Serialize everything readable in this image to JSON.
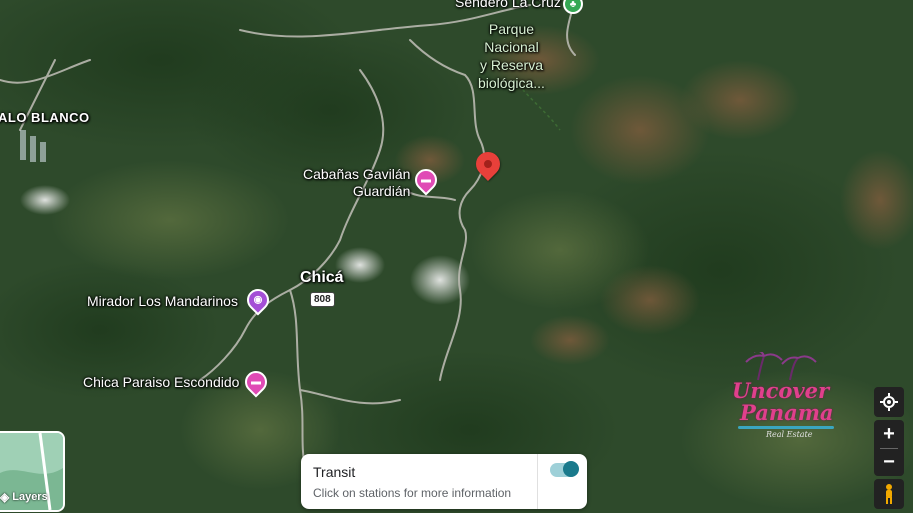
{
  "labels": {
    "trail": "Sendero La Cruz",
    "park": [
      "Parque",
      "Nacional",
      "y Reserva",
      "biológica..."
    ],
    "area": "ALO BLANCO",
    "cabanas": [
      "Cabañas Gavilán",
      "Guardián"
    ],
    "town": "Chicá",
    "road": "808",
    "mirador": "Mirador Los Mandarinos",
    "paraiso": "Chica Paraiso Escondido"
  },
  "layers": {
    "label": "Layers"
  },
  "transit": {
    "title": "Transit",
    "subtitle": "Click on stations for more information",
    "enabled": true
  },
  "logo": {
    "line1": "Uncover",
    "line2": "Panama",
    "tagline": "Real Estate"
  },
  "controls": {
    "locate": "my-location",
    "zoom_in": "+",
    "zoom_out": "−"
  },
  "colors": {
    "pin_red": "#e8403a",
    "poi_pink": "#e04bb5",
    "poi_purple": "#a44fd6",
    "trail_green": "#34a853",
    "toggle": "#1a7a8c",
    "logo_pink": "#e0408c"
  }
}
